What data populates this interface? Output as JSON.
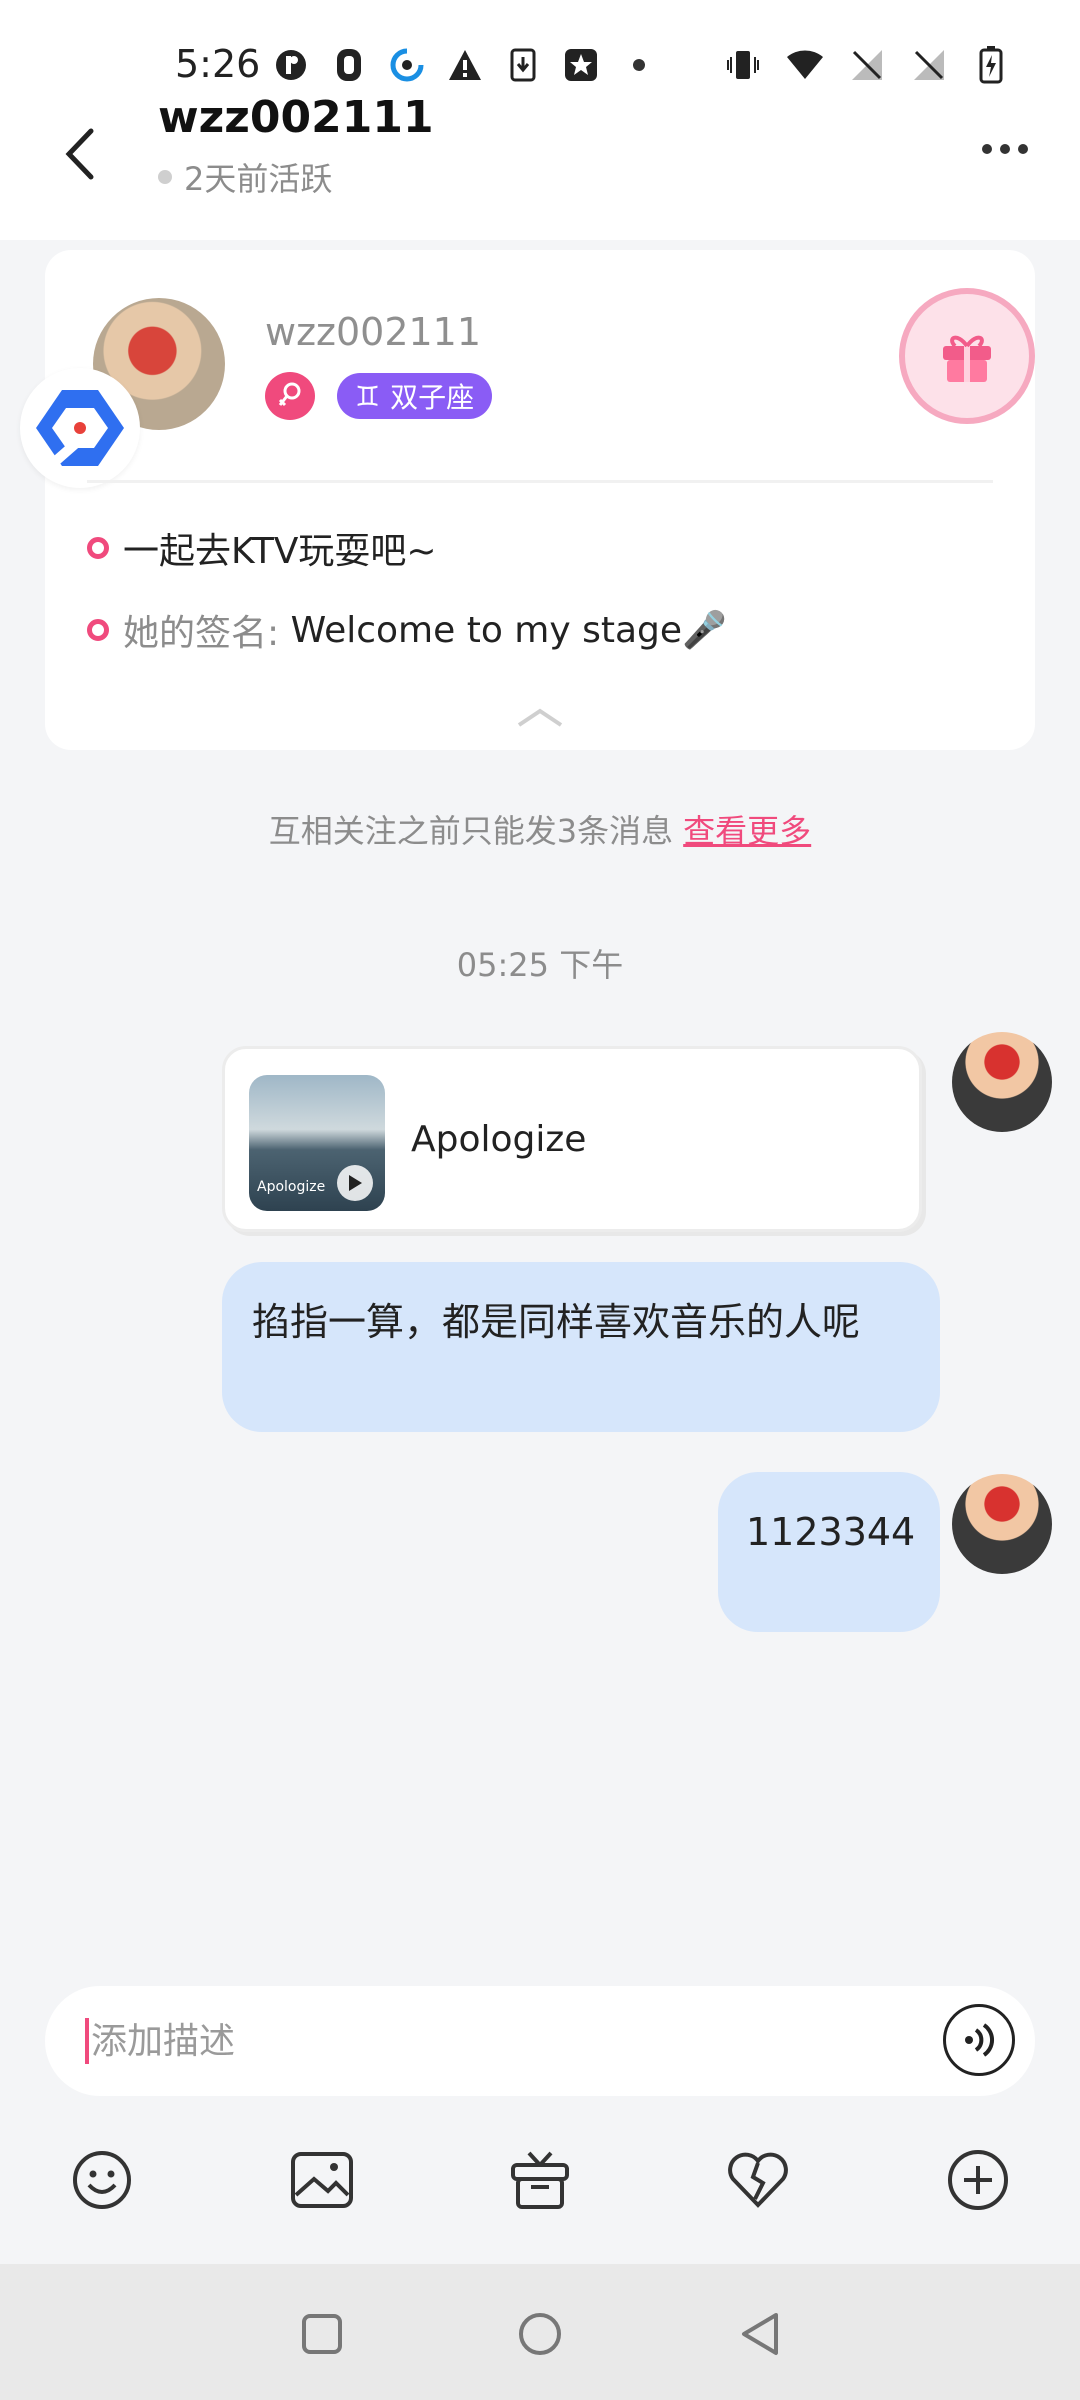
{
  "status_bar": {
    "time": "5:26",
    "left_icons": [
      "tiktok-icon",
      "shield-icon",
      "browser-icon",
      "warning-icon",
      "download-icon",
      "star-icon",
      "dot-icon"
    ],
    "right_icons": [
      "vibrate-icon",
      "wifi-icon",
      "no-signal-icon",
      "no-signal-icon",
      "battery-charging-icon"
    ]
  },
  "header": {
    "title": "wzz002111",
    "subtitle": "2天前活跃"
  },
  "profile": {
    "name": "wzz002111",
    "zodiac": "双子座",
    "zodiac_symbol": "♊",
    "line1": "一起去KTV玩耍吧~",
    "signature_label": "她的签名:",
    "signature_text": " Welcome to my stage🎤"
  },
  "notice": {
    "text": "互相关注之前只能发3条消息",
    "link": "查看更多"
  },
  "timestamp": "05:25 下午",
  "messages": {
    "music": {
      "title": "Apologize",
      "thumb_text": "Apologize"
    },
    "text1": "掐指一算，都是同样喜欢音乐的人呢",
    "text2": "1123344"
  },
  "input": {
    "placeholder": "添加描述"
  },
  "toolbar": [
    "emoji-icon",
    "image-icon",
    "gift-box-icon",
    "broken-heart-icon",
    "plus-icon"
  ],
  "colors": {
    "accent": "#f04a7d",
    "bubble": "#d6e6fb",
    "zodiac": "#8a5cf5",
    "background": "#f4f5f7"
  }
}
